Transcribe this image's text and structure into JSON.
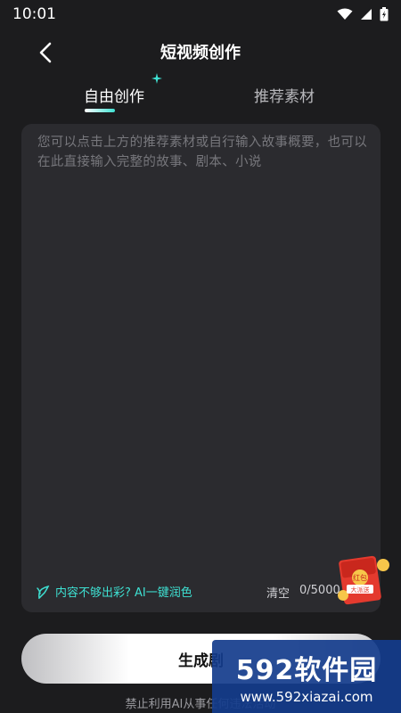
{
  "status_bar": {
    "time": "10:01"
  },
  "header": {
    "title": "短视频创作"
  },
  "tabs": [
    {
      "label": "自由创作",
      "active": true
    },
    {
      "label": "推荐素材",
      "active": false
    }
  ],
  "editor": {
    "placeholder": "您可以点击上方的推荐素材或自行输入故事概要，也可以在此直接输入完整的故事、剧本、小说",
    "ai_polish_label": "内容不够出彩? AI一键润色",
    "clear_label": "清空",
    "char_count": "0/5000"
  },
  "promo": {
    "redpack_text": "红包\n大派送"
  },
  "actions": {
    "generate_label": "生成剧"
  },
  "disclaimer": "禁止利用AI从事任何违法活动",
  "watermark": {
    "brand": "592软件园",
    "url": "www.592xiazai.com"
  },
  "colors": {
    "background": "#1c1c1e",
    "accent": "#3ee0d2",
    "editor_bg": "#2b2b2f"
  }
}
